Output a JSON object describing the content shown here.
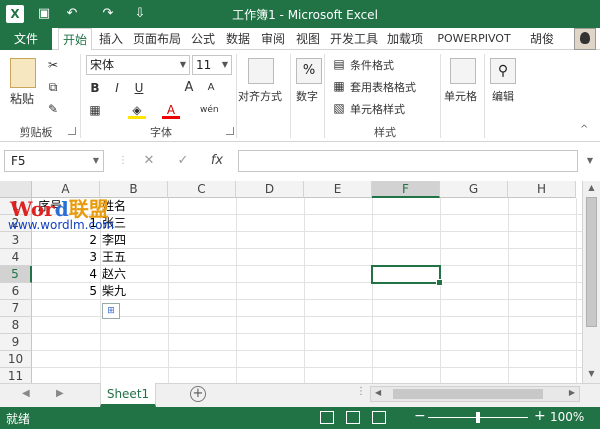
{
  "window": {
    "title": "工作簿1 - Microsoft Excel",
    "app_logo": "X",
    "quick_access": [
      "save-icon",
      "undo-icon",
      "redo-icon",
      "customize-icon"
    ]
  },
  "ribbon_tabs": [
    {
      "label": "文件",
      "kind": "file"
    },
    {
      "label": "开始",
      "kind": "active"
    },
    {
      "label": "插入"
    },
    {
      "label": "页面布局"
    },
    {
      "label": "公式"
    },
    {
      "label": "数据"
    },
    {
      "label": "审阅"
    },
    {
      "label": "视图"
    },
    {
      "label": "开发工具"
    },
    {
      "label": "加载项"
    },
    {
      "label": "POWERPIVOT"
    },
    {
      "label": "胡俊"
    }
  ],
  "ribbon": {
    "clipboard": {
      "paste_label": "粘贴",
      "group_label": "剪贴板"
    },
    "font": {
      "font_name": "宋体",
      "font_size": "11",
      "bold": "B",
      "italic": "I",
      "underline": "U",
      "grow": "A",
      "shrink": "A",
      "font_color": "A",
      "phonetic": "wén",
      "group_label": "字体"
    },
    "alignment": {
      "label": "对齐方式"
    },
    "number": {
      "symbol": "%",
      "label": "数字"
    },
    "styles": {
      "conditional": "条件格式",
      "table": "套用表格格式",
      "cell_styles": "单元格样式",
      "group_label": "样式"
    },
    "cells": {
      "label": "单元格"
    },
    "editing": {
      "label": "编辑"
    }
  },
  "formula_bar": {
    "name_box": "F5",
    "cancel": "✕",
    "enter": "✓",
    "fx": "fx",
    "value": ""
  },
  "grid": {
    "columns": [
      "A",
      "B",
      "C",
      "D",
      "E",
      "F",
      "G",
      "H"
    ],
    "selected_column": "F",
    "rows": [
      "1",
      "2",
      "3",
      "4",
      "5",
      "6",
      "7",
      "8",
      "9",
      "10",
      "11"
    ],
    "selected_row": "5",
    "cells": {
      "A1": "序号",
      "B1": "姓名",
      "A2": "1",
      "B2": "张三",
      "A3": "2",
      "B3": "李四",
      "A4": "3",
      "B4": "王五",
      "A5": "4",
      "B5": "赵六",
      "A6": "5",
      "B6": "柴九"
    },
    "active_cell": "F5"
  },
  "watermark": {
    "logo_part1": "Wor",
    "logo_part2": "d",
    "logo_part3": "联盟",
    "url": "www.wordlm.com"
  },
  "sheets": {
    "tabs": [
      "Sheet1"
    ],
    "add_symbol": "+"
  },
  "status_bar": {
    "status": "就绪",
    "zoom_minus": "−",
    "zoom_plus": "+",
    "zoom": "100%",
    "zoom_level_percent": 100
  },
  "colors": {
    "accent": "#217346"
  }
}
